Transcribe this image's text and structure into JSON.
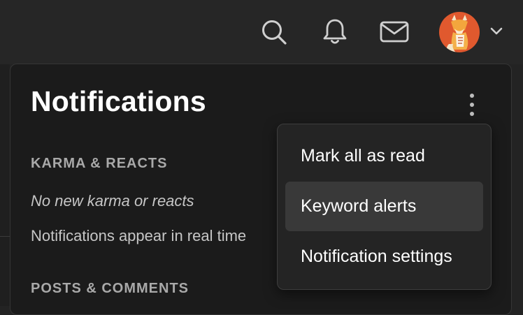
{
  "header": {
    "icons": [
      "search-icon",
      "bell-icon",
      "mail-icon",
      "avatar-fox",
      "chevron-down-icon"
    ],
    "avatar_bg": "#e0592e",
    "icon_color": "#cfcfcf"
  },
  "notifications": {
    "title": "Notifications",
    "sections": [
      {
        "heading": "KARMA & REACTS",
        "empty_text": "No new karma or reacts",
        "info_text": "Notifications appear in real time"
      },
      {
        "heading": "POSTS & COMMENTS"
      }
    ]
  },
  "menu": {
    "items": [
      {
        "label": "Mark all as read"
      },
      {
        "label": "Keyword alerts",
        "active": true
      },
      {
        "label": "Notification settings"
      }
    ]
  },
  "colors": {
    "page_bg": "#232323",
    "panel_bg": "#1b1b1b",
    "menu_bg": "#242424",
    "menu_highlight": "#393939",
    "heading_text": "#a9a9a9",
    "body_text": "#c6c6c6"
  }
}
